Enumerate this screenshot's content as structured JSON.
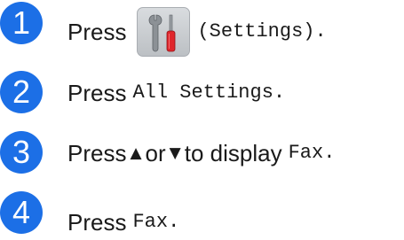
{
  "steps": [
    {
      "number": "1",
      "press": "Press",
      "icon": "settings-tools-icon",
      "target": "(Settings)."
    },
    {
      "number": "2",
      "press": "Press",
      "target": "All Settings."
    },
    {
      "number": "3",
      "press": "Press",
      "up_arrow": "▲",
      "or": "or",
      "down_arrow": "▼",
      "to_display": "to display",
      "target": "Fax."
    },
    {
      "number": "4",
      "press": "Press",
      "target": "Fax."
    }
  ],
  "colors": {
    "step_badge": "#1c6fe6",
    "screwdriver_handle": "#e0262b",
    "wrench": "#8c9196"
  }
}
